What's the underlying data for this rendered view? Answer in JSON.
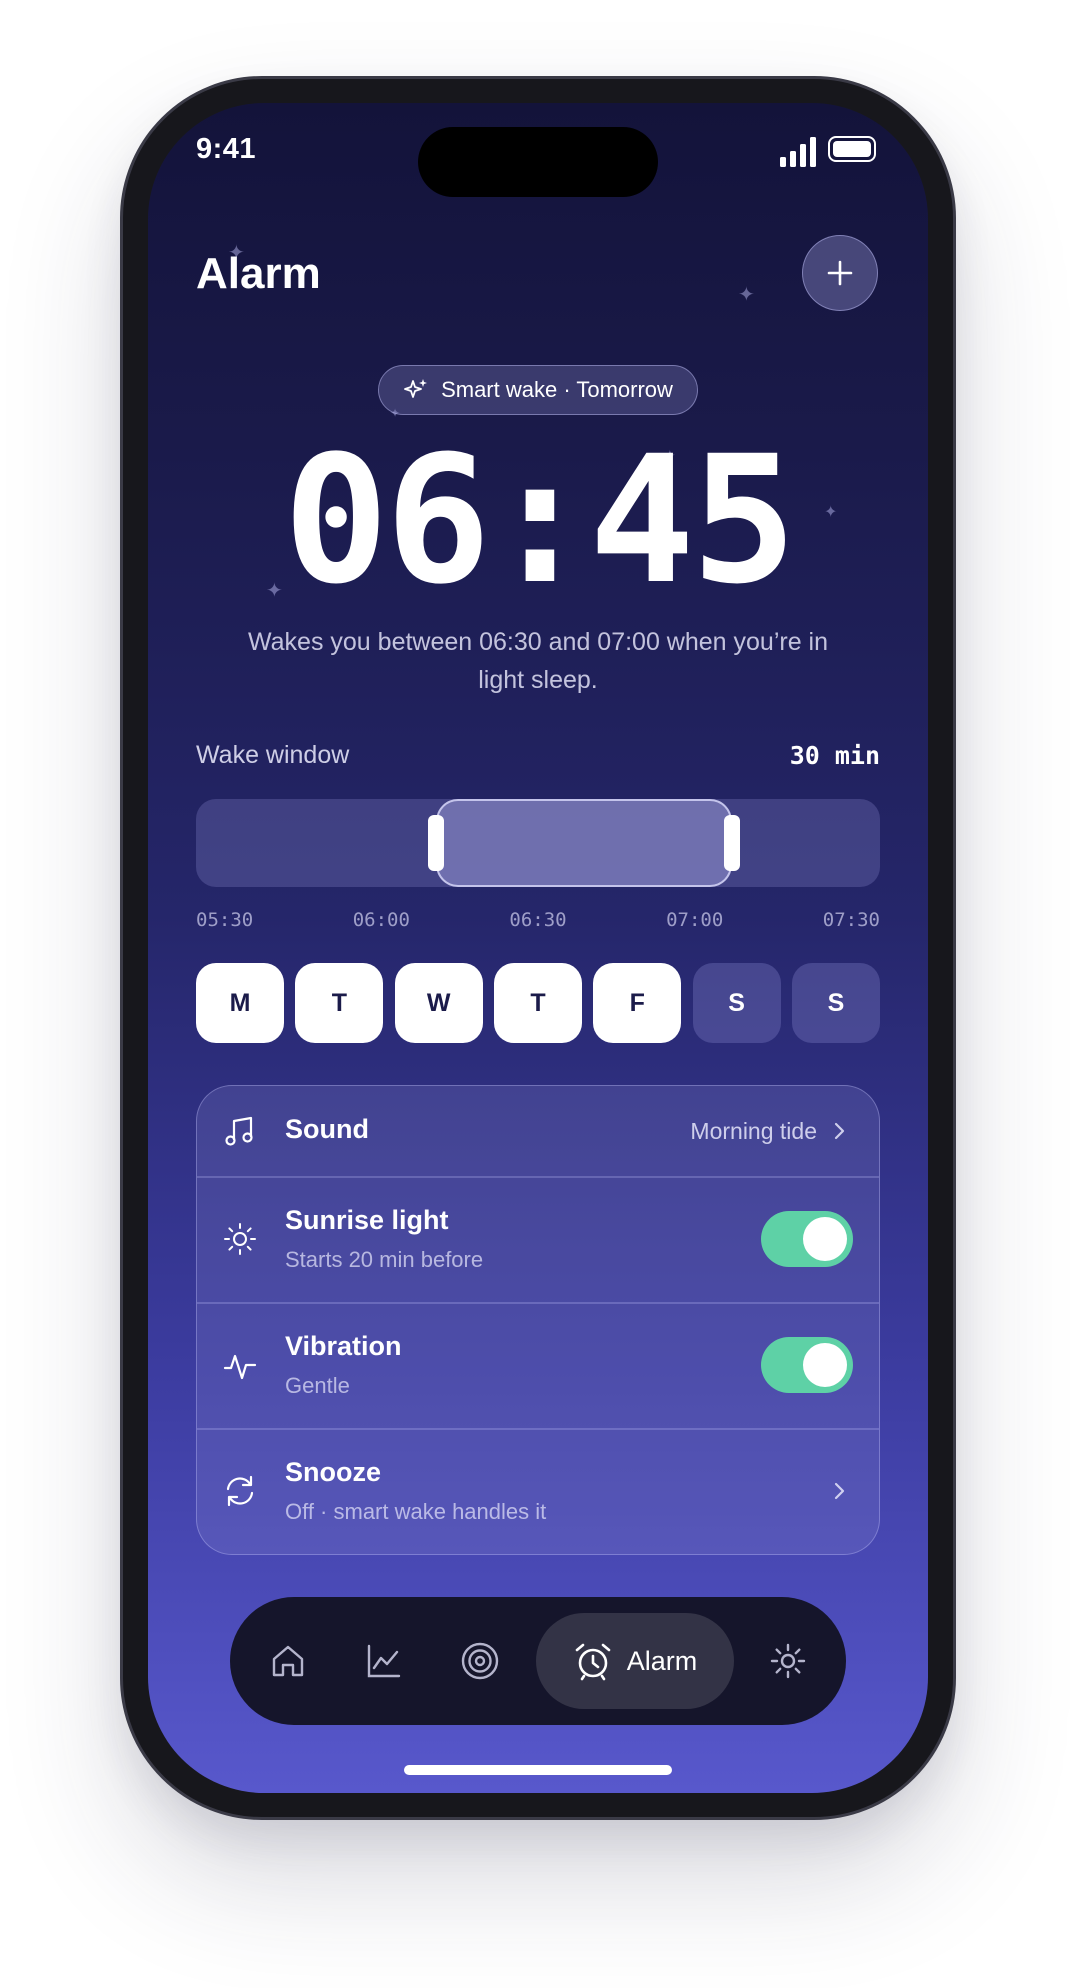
{
  "status_bar": {
    "time": "9:41"
  },
  "header": {
    "title": "Alarm",
    "add_icon": "plus-icon"
  },
  "smart_wake": {
    "label": "Smart wake · Tomorrow",
    "icon": "sparkles-icon"
  },
  "alarm": {
    "time": "06:45",
    "description": "Wakes you between 06:30 and 07:00 when you’re in light sleep."
  },
  "wake_window": {
    "label": "Wake window",
    "value": "30 min",
    "ticks": [
      "05:30",
      "06:00",
      "06:30",
      "07:00",
      "07:30"
    ],
    "range_start": "06:30",
    "range_end": "07:00"
  },
  "days": [
    {
      "label": "M",
      "active": true
    },
    {
      "label": "T",
      "active": true
    },
    {
      "label": "W",
      "active": true
    },
    {
      "label": "T",
      "active": true
    },
    {
      "label": "F",
      "active": true
    },
    {
      "label": "S",
      "active": false
    },
    {
      "label": "S",
      "active": false
    }
  ],
  "settings": {
    "sound": {
      "title": "Sound",
      "value": "Morning tide",
      "icon": "music-note-icon"
    },
    "sunrise": {
      "title": "Sunrise light",
      "subtitle": "Starts 20 min before",
      "enabled": true,
      "icon": "sun-icon"
    },
    "vibration": {
      "title": "Vibration",
      "subtitle": "Gentle",
      "enabled": true,
      "icon": "pulse-icon"
    },
    "snooze": {
      "title": "Snooze",
      "subtitle": "Off · smart wake handles it",
      "icon": "refresh-icon"
    }
  },
  "nav": {
    "active_label": "Alarm",
    "items": [
      "home-icon",
      "chart-icon",
      "target-icon",
      "alarm-clock-icon",
      "settings-icon"
    ]
  },
  "colors": {
    "background_top": "#13133a",
    "background_bottom": "#5858cc",
    "toggle_on": "#5ed1a6",
    "nav_bar": "#15152b"
  }
}
